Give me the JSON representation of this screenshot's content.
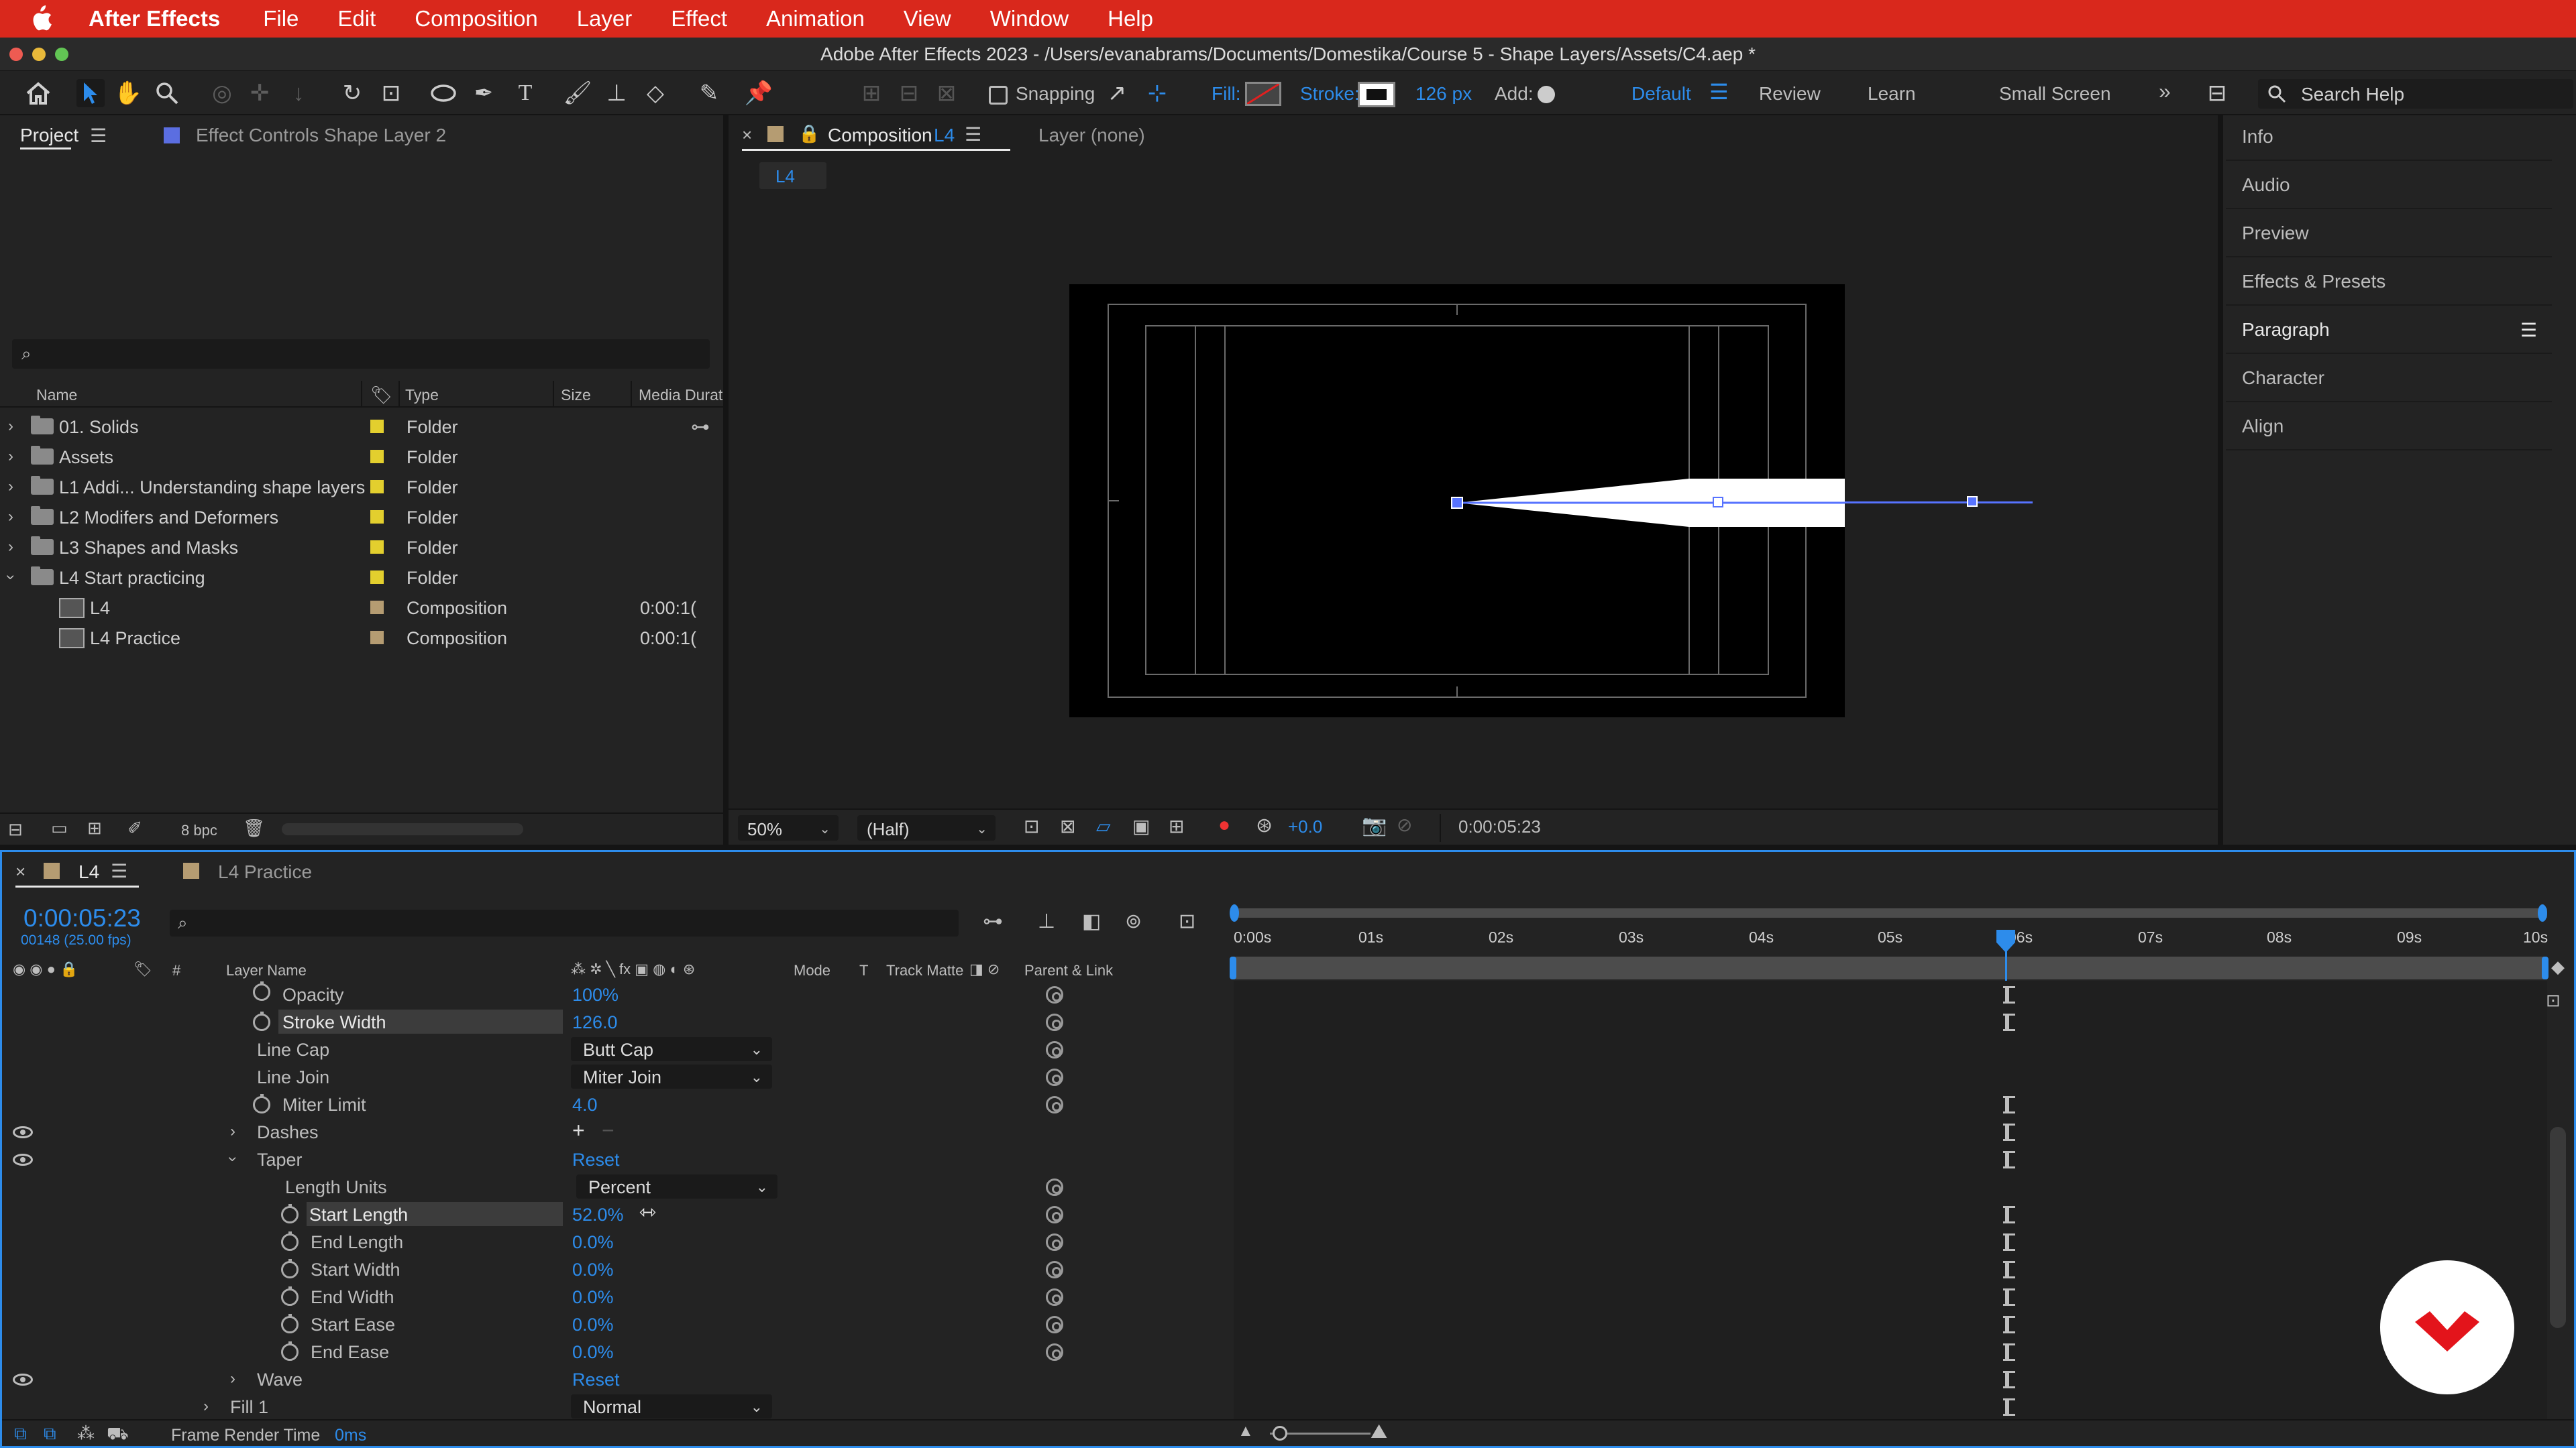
{
  "menubar": {
    "app_name": "After Effects",
    "items": [
      "File",
      "Edit",
      "Composition",
      "Layer",
      "Effect",
      "Animation",
      "View",
      "Window",
      "Help"
    ]
  },
  "window_title": "Adobe After Effects 2023 - /Users/evanabrams/Documents/Domestika/Course 5 - Shape Layers/Assets/C4.aep *",
  "toolbar": {
    "snapping_label": "Snapping",
    "fill_label": "Fill:",
    "stroke_label": "Stroke:",
    "stroke_width": "126 px",
    "add_label": "Add:",
    "workspaces": [
      "Default",
      "Review",
      "Learn",
      "Small Screen"
    ],
    "search_placeholder": "Search Help"
  },
  "project_panel": {
    "tab_project": "Project",
    "tab_effect_controls": "Effect Controls Shape Layer 2",
    "columns": {
      "name": "Name",
      "type": "Type",
      "size": "Size",
      "duration": "Media Durat"
    },
    "items": [
      {
        "name": "01. Solids",
        "type": "Folder",
        "duration": ""
      },
      {
        "name": "Assets",
        "type": "Folder",
        "duration": ""
      },
      {
        "name": "L1 Addi... Understanding shape layers",
        "type": "Folder",
        "duration": ""
      },
      {
        "name": "L2 Modifers and Deformers",
        "type": "Folder",
        "duration": ""
      },
      {
        "name": "L3 Shapes and Masks",
        "type": "Folder",
        "duration": ""
      },
      {
        "name": "L4 Start practicing",
        "type": "Folder",
        "duration": ""
      },
      {
        "name": "L4",
        "type": "Composition",
        "duration": "0:00:1("
      },
      {
        "name": "L4 Practice",
        "type": "Composition",
        "duration": "0:00:1("
      }
    ],
    "bpc": "8 bpc"
  },
  "composition_panel": {
    "tab_label": "Composition",
    "tab_comp": "L4",
    "layer_tab": "Layer (none)",
    "breadcrumb": "L4",
    "zoom": "50%",
    "resolution": "(Half)",
    "exposure": "+0.0",
    "timecode": "0:00:05:23"
  },
  "right_panels": [
    "Info",
    "Audio",
    "Preview",
    "Effects & Presets",
    "Paragraph",
    "Character",
    "Align"
  ],
  "timeline": {
    "tab_l4": "L4",
    "tab_practice": "L4 Practice",
    "timecode": "0:00:05:23",
    "frame_info": "00148 (25.00 fps)",
    "col_layer_name": "Layer Name",
    "col_mode": "Mode",
    "col_t": "T",
    "col_track_matte": "Track Matte",
    "col_parent": "Parent & Link",
    "ruler": [
      "0:00s",
      "01s",
      "02s",
      "03s",
      "04s",
      "05s",
      "06s",
      "07s",
      "08s",
      "09s",
      "10s"
    ],
    "props": {
      "opacity": {
        "label": "Opacity",
        "value": "100%"
      },
      "stroke_width": {
        "label": "Stroke Width",
        "value": "126.0"
      },
      "line_cap": {
        "label": "Line Cap",
        "value": "Butt Cap"
      },
      "line_join": {
        "label": "Line Join",
        "value": "Miter Join"
      },
      "miter_limit": {
        "label": "Miter Limit",
        "value": "4.0"
      },
      "dashes": {
        "label": "Dashes"
      },
      "taper": {
        "label": "Taper",
        "reset": "Reset"
      },
      "length_units": {
        "label": "Length Units",
        "value": "Percent"
      },
      "start_length": {
        "label": "Start Length",
        "value": "52.0%"
      },
      "end_length": {
        "label": "End Length",
        "value": "0.0%"
      },
      "start_width": {
        "label": "Start Width",
        "value": "0.0%"
      },
      "end_width": {
        "label": "End Width",
        "value": "0.0%"
      },
      "start_ease": {
        "label": "Start Ease",
        "value": "0.0%"
      },
      "end_ease": {
        "label": "End Ease",
        "value": "0.0%"
      },
      "wave": {
        "label": "Wave",
        "reset": "Reset"
      },
      "fill": {
        "label": "Fill 1",
        "value": "Normal"
      }
    },
    "footer_label": "Frame Render Time",
    "footer_value": "0ms"
  },
  "colors": {
    "accent": "#2d8ceb",
    "menubar": "#d9281c",
    "panel": "#232323",
    "label_yellow": "#e3cf2e",
    "label_tan": "#b59c72"
  },
  "watermark": "domestika-logo"
}
